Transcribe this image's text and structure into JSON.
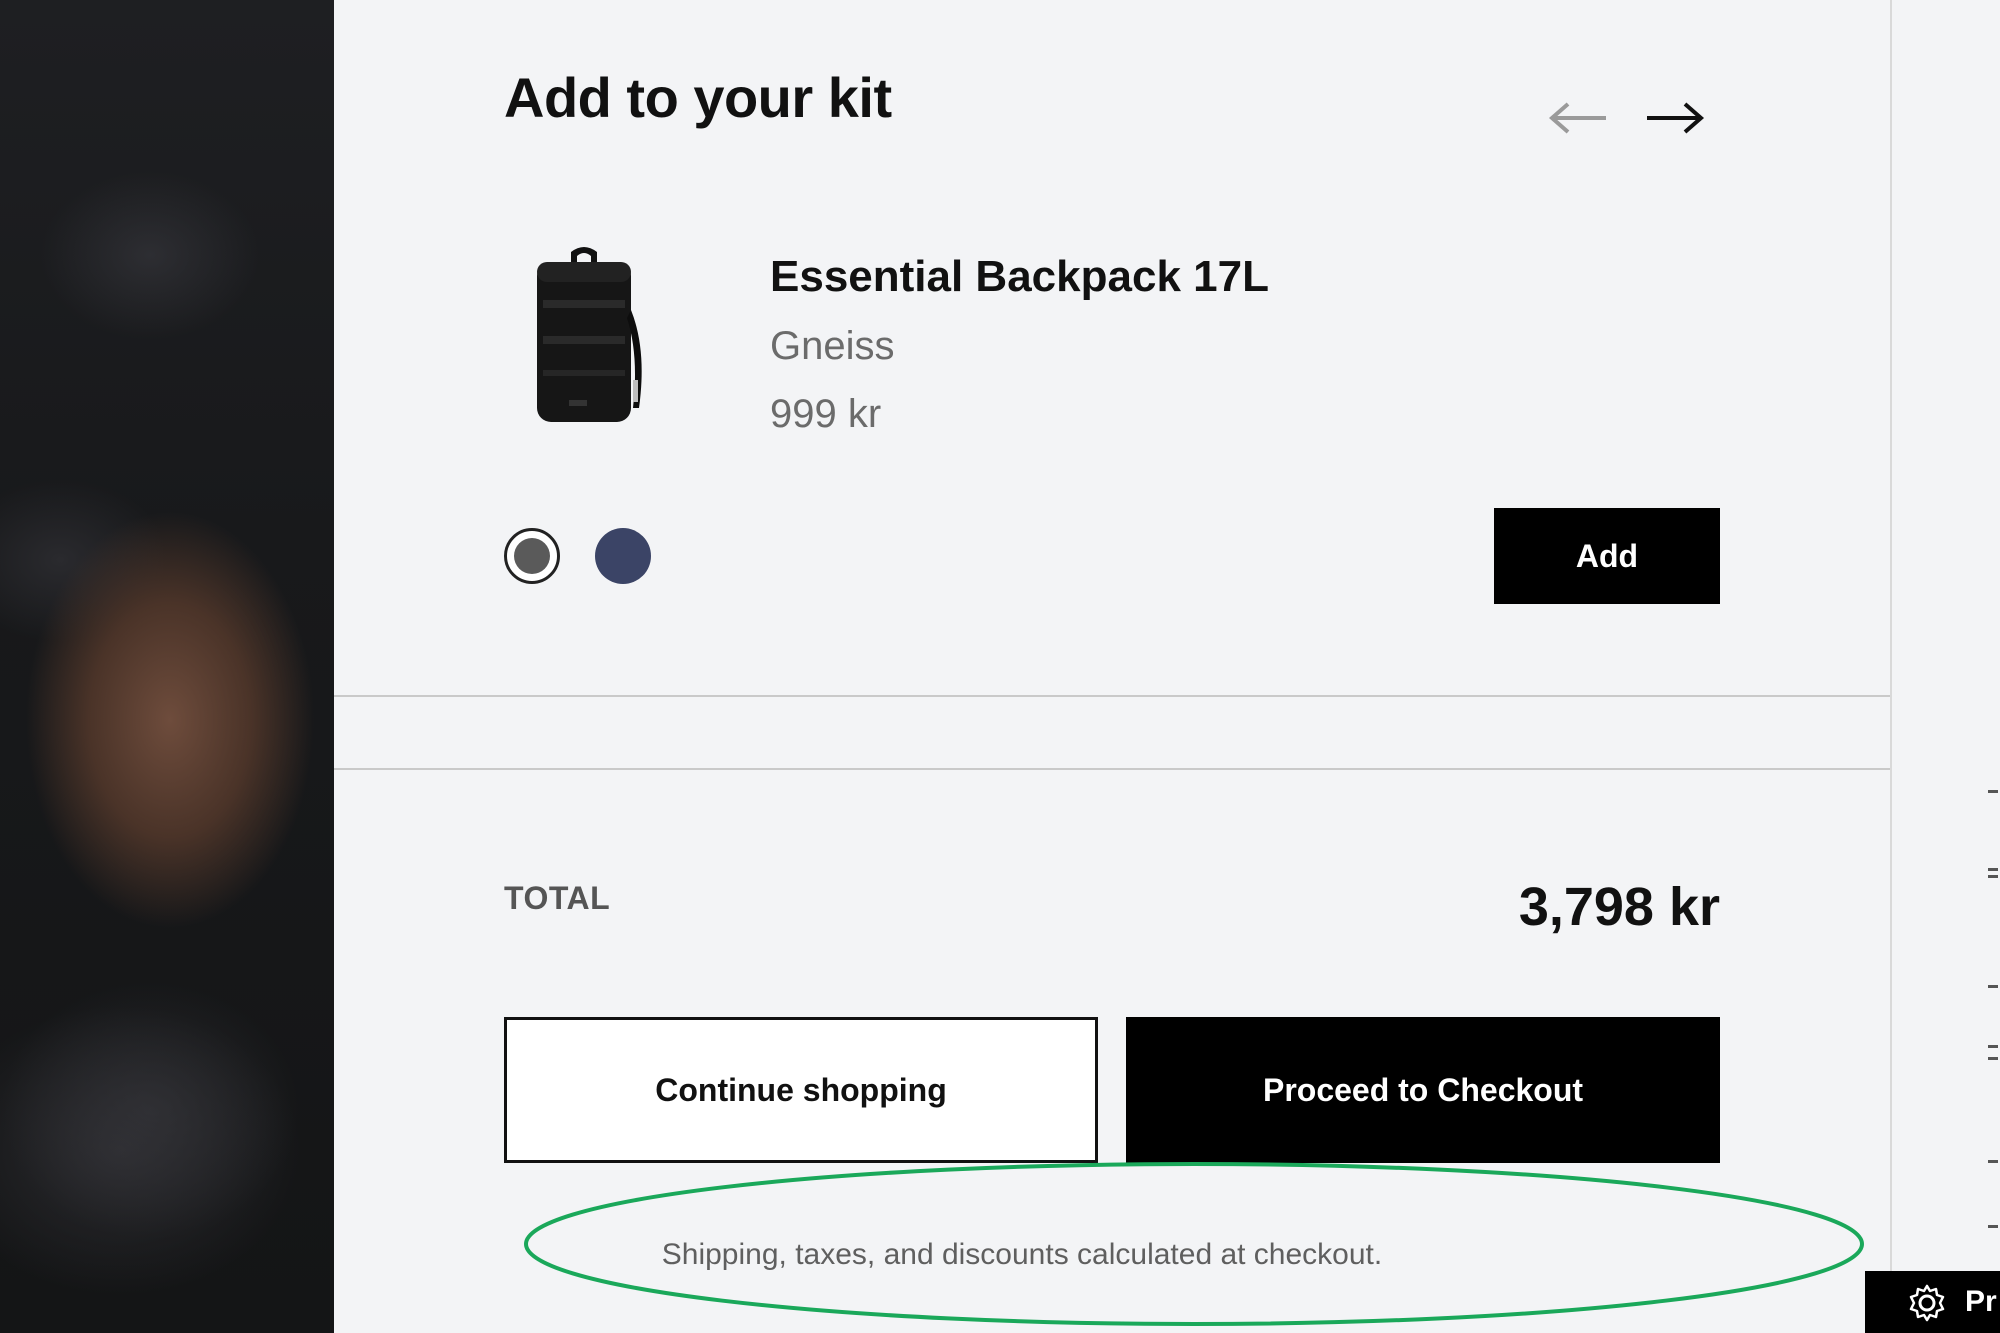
{
  "kit": {
    "title": "Add to your kit",
    "prev_icon": "arrow-left-icon",
    "next_icon": "arrow-right-icon"
  },
  "product": {
    "name": "Essential Backpack 17L",
    "variant": "Gneiss",
    "price": "999 kr",
    "image_icon": "backpack-icon",
    "swatches": [
      {
        "name": "Gneiss",
        "color": "#5a5a5a",
        "selected": true
      },
      {
        "name": "Navy",
        "color": "#3b4466",
        "selected": false
      }
    ],
    "add_label": "Add"
  },
  "summary": {
    "total_label": "TOTAL",
    "total_value": "3,798 kr",
    "continue_label": "Continue shopping",
    "checkout_label": "Proceed to Checkout",
    "note": "Shipping, taxes, and discounts calculated at checkout."
  },
  "privacy": {
    "label": "Pr",
    "icon": "gear-icon"
  },
  "colors": {
    "highlight": "#1aa85a",
    "panel_bg": "#f3f4f6",
    "primary": "#000000"
  }
}
